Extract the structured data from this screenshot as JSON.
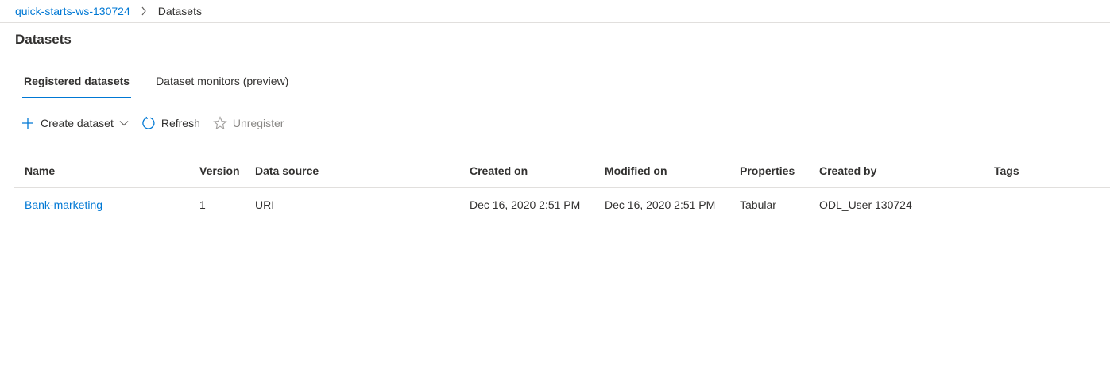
{
  "breadcrumb": {
    "workspace": "quick-starts-ws-130724",
    "current": "Datasets"
  },
  "page": {
    "title": "Datasets"
  },
  "tabs": [
    {
      "label": "Registered datasets",
      "active": true
    },
    {
      "label": "Dataset monitors (preview)",
      "active": false
    }
  ],
  "toolbar": {
    "create_label": "Create dataset",
    "refresh_label": "Refresh",
    "unregister_label": "Unregister"
  },
  "table": {
    "columns": [
      "Name",
      "Version",
      "Data source",
      "Created on",
      "Modified on",
      "Properties",
      "Created by",
      "Tags"
    ],
    "rows": [
      {
        "name": "Bank-marketing",
        "version": "1",
        "data_source": "URI",
        "created_on": "Dec 16, 2020 2:51 PM",
        "modified_on": "Dec 16, 2020 2:51 PM",
        "properties": "Tabular",
        "created_by": "ODL_User 130724",
        "tags": ""
      }
    ]
  },
  "colors": {
    "accent": "#0078d4",
    "text": "#323130",
    "disabled": "#8a8886",
    "divider": "#e1dfdd"
  }
}
